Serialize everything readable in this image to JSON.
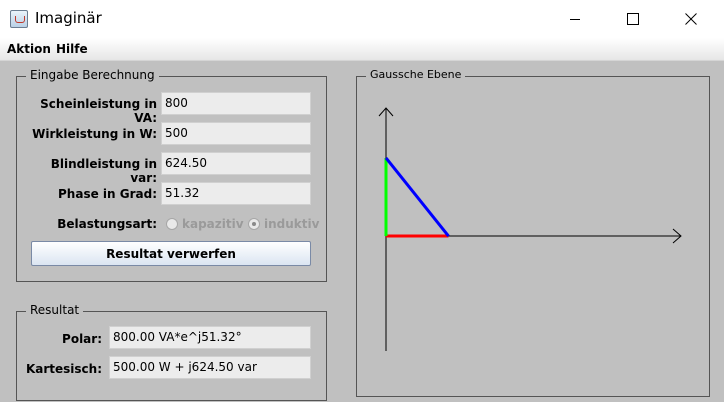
{
  "window": {
    "title": "Imaginär"
  },
  "menu": [
    {
      "label": "Aktion"
    },
    {
      "label": "Hilfe"
    }
  ],
  "input_group": {
    "title": "Eingabe Berechnung",
    "fields": [
      {
        "label": "Scheinleistung in VA:",
        "value": "800"
      },
      {
        "label": "Wirkleistung in W:",
        "value": "500"
      },
      {
        "label": "Blindleistung in var:",
        "value": "624.50"
      },
      {
        "label": "Phase in Grad:",
        "value": "51.32"
      }
    ],
    "load_type": {
      "label": "Belastungsart:",
      "options": [
        {
          "label": "kapazitiv",
          "selected": false
        },
        {
          "label": "induktiv",
          "selected": true
        }
      ]
    },
    "discard_button": "Resultat verwerfen"
  },
  "result_group": {
    "title": "Resultat",
    "polar_label": "Polar:",
    "polar_value": "800.00 VA*e^j51.32°",
    "cartesian_label": "Kartesisch:",
    "cartesian_value": "500.00 W + j624.50 var"
  },
  "plot": {
    "title": "Gaussche Ebene",
    "real": 500,
    "imag": 624.5,
    "colors": {
      "real": "#ff0000",
      "imag": "#00ff00",
      "apparent": "#0000ff",
      "axes": "#000000"
    }
  }
}
